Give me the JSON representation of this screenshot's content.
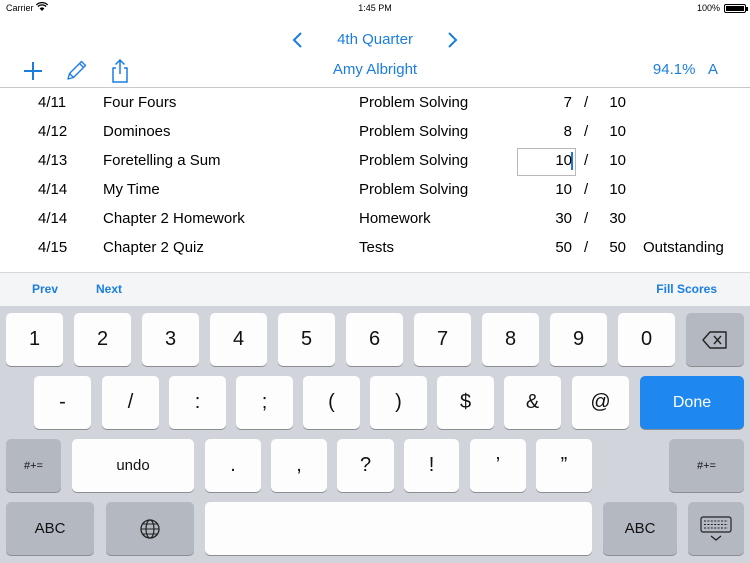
{
  "status_bar": {
    "carrier": "Carrier",
    "time": "1:45 PM",
    "battery": "100%",
    "battery_level": 1.0
  },
  "header": {
    "quarter": "4th Quarter",
    "student": "Amy Albright",
    "grade_percent": "94.1%",
    "grade_letter": "A"
  },
  "toolbar": {
    "icons": [
      "plus-icon",
      "pencil-icon",
      "share-icon"
    ]
  },
  "assignments": [
    {
      "date": "4/11",
      "name": "Four Fours",
      "category": "Problem Solving",
      "score": "7",
      "slash": "/",
      "max": "10",
      "comment": ""
    },
    {
      "date": "4/12",
      "name": "Dominoes",
      "category": "Problem Solving",
      "score": "8",
      "slash": "/",
      "max": "10",
      "comment": ""
    },
    {
      "date": "4/13",
      "name": "Foretelling a Sum",
      "category": "Problem Solving",
      "score": "10",
      "slash": "/",
      "max": "10",
      "comment": ""
    },
    {
      "date": "4/14",
      "name": "My Time",
      "category": "Problem Solving",
      "score": "10",
      "slash": "/",
      "max": "10",
      "comment": ""
    },
    {
      "date": "4/14",
      "name": "Chapter 2 Homework",
      "category": "Homework",
      "score": "30",
      "slash": "/",
      "max": "30",
      "comment": ""
    },
    {
      "date": "4/15",
      "name": "Chapter 2 Quiz",
      "category": "Tests",
      "score": "50",
      "slash": "/",
      "max": "50",
      "comment": "Outstanding"
    }
  ],
  "accessory_bar": {
    "prev": "Prev",
    "next": "Next",
    "fill_scores": "Fill Scores"
  },
  "keyboard": {
    "row1": [
      "1",
      "2",
      "3",
      "4",
      "5",
      "6",
      "7",
      "8",
      "9",
      "0"
    ],
    "row2": [
      "-",
      "/",
      ":",
      ";",
      "(",
      ")",
      "$",
      "&",
      "@"
    ],
    "done": "Done",
    "row3_side": "#+=",
    "undo": "undo",
    "row3": [
      ".",
      ",",
      "?",
      "!",
      "’",
      "”"
    ],
    "abc": "ABC"
  }
}
